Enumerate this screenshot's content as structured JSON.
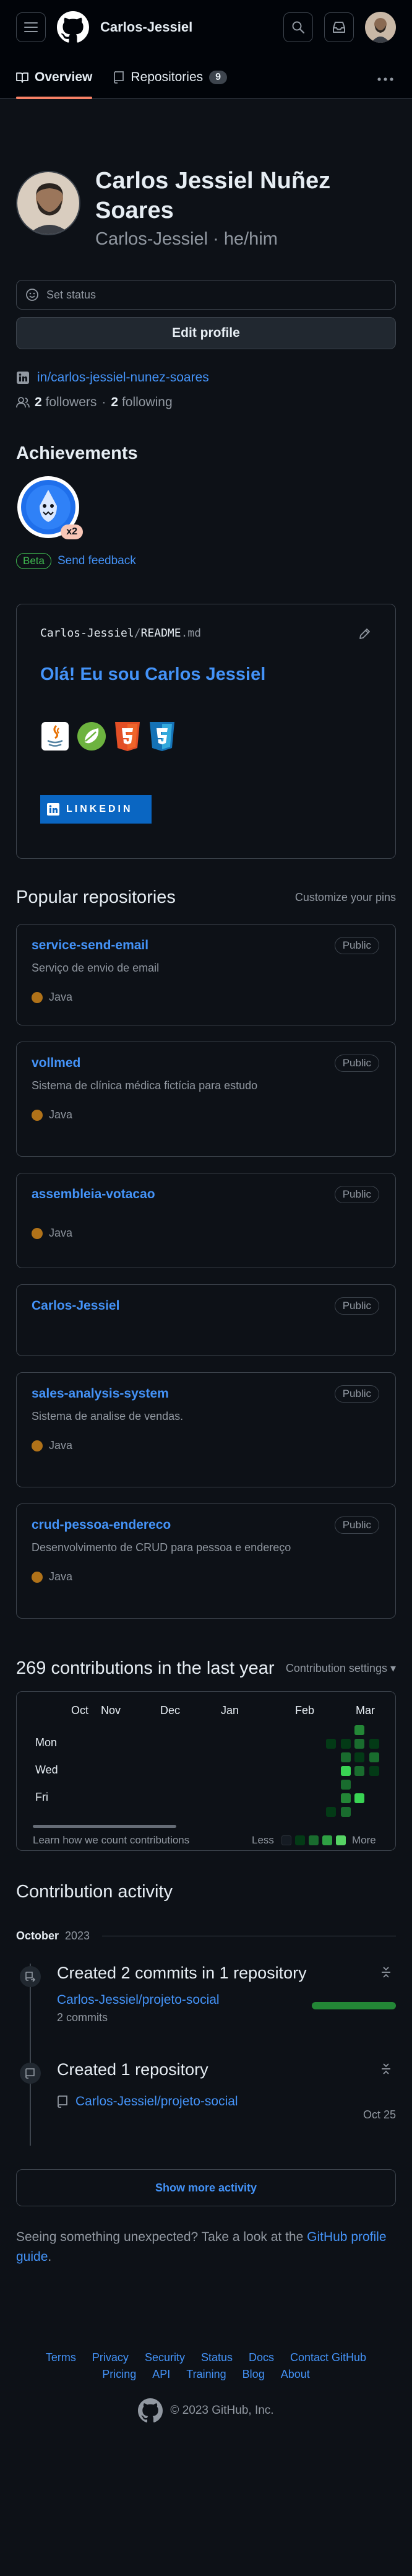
{
  "header": {
    "username": "Carlos-Jessiel"
  },
  "tabs": [
    {
      "label": "Overview"
    },
    {
      "label": "Repositories",
      "count": "9"
    }
  ],
  "profile": {
    "full_name": "Carlos Jessiel Nuñez Soares",
    "login": "Carlos-Jessiel · he/him",
    "set_status": "Set status",
    "edit_profile": "Edit profile",
    "linkedin": "in/carlos-jessiel-nunez-soares",
    "followers_count": "2",
    "followers_label": "followers",
    "separator": "·",
    "following_count": "2",
    "following_label": "following"
  },
  "achievements": {
    "title": "Achievements",
    "badge_multiplier": "x2",
    "beta": "Beta",
    "feedback": "Send feedback"
  },
  "readme": {
    "user": "Carlos-Jessiel",
    "slash": "/",
    "file": "README",
    "ext": ".md",
    "heading": "Olá! Eu sou Carlos Jessiel",
    "linkedin_badge": "LINKEDIN"
  },
  "popular": {
    "title": "Popular repositories",
    "customize": "Customize your pins",
    "public_label": "Public",
    "repos": [
      {
        "name": "service-send-email",
        "desc": "Serviço de envio de email",
        "lang": "Java"
      },
      {
        "name": "vollmed",
        "desc": "Sistema de clínica médica fictícia para estudo",
        "lang": "Java"
      },
      {
        "name": "assembleia-votacao",
        "desc": "",
        "lang": "Java"
      },
      {
        "name": "Carlos-Jessiel",
        "desc": "",
        "lang": ""
      },
      {
        "name": "sales-analysis-system",
        "desc": "Sistema de analise de vendas.",
        "lang": "Java"
      },
      {
        "name": "crud-pessoa-endereco",
        "desc": "Desenvolvimento de CRUD para pessoa e endereço",
        "lang": "Java"
      }
    ]
  },
  "contributions": {
    "title": "269 contributions in the last year",
    "settings": "Contribution settings ▾",
    "months": [
      "Oct",
      "Nov",
      "Dec",
      "Jan",
      "Feb",
      "Mar"
    ],
    "days": [
      "Mon",
      "Wed",
      "Fri"
    ],
    "learn": "Learn how we count contributions",
    "less": "Less",
    "more": "More"
  },
  "activity": {
    "title": "Contribution activity",
    "month": "October",
    "year": "2023",
    "event1": {
      "title": "Created 2 commits in 1 repository",
      "repo": "Carlos-Jessiel/projeto-social",
      "commits": "2 commits"
    },
    "event2": {
      "title": "Created 1 repository",
      "repo": "Carlos-Jessiel/projeto-social",
      "date": "Oct 25"
    },
    "show_more": "Show more activity",
    "unexpected_text": "Seeing something unexpected? Take a look at the",
    "unexpected_link": "GitHub profile guide",
    "unexpected_end": "."
  },
  "footer": {
    "links": [
      "Terms",
      "Privacy",
      "Security",
      "Status",
      "Docs",
      "Contact GitHub",
      "Pricing",
      "API",
      "Training",
      "Blog",
      "About"
    ],
    "copyright": "© 2023 GitHub, Inc."
  },
  "colors": {
    "accent_link": "#4493f8",
    "tab_underline": "#f78166",
    "java": "#b07219",
    "success": "#238636"
  }
}
